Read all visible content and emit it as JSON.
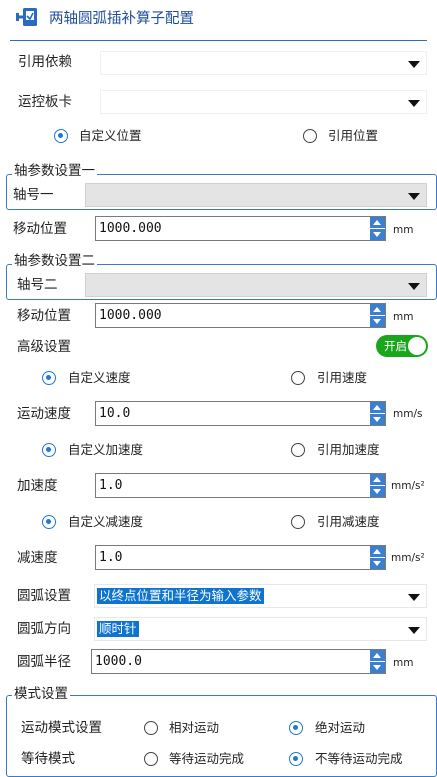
{
  "header": {
    "title": "两轴圆弧插补算子配置",
    "icon": "plugin-icon"
  },
  "colors": {
    "accent": "#1f78d1",
    "toggle_on": "#1aa61a",
    "selection": "#0f74d0",
    "group_border": "#3a78c8"
  },
  "ref_dependency": {
    "label": "引用依赖",
    "value": ""
  },
  "motion_card": {
    "label": "运控板卡",
    "value": ""
  },
  "position_mode": {
    "option_custom": "自定义位置",
    "option_ref": "引用位置",
    "selected": "custom"
  },
  "axis1": {
    "group_title": "轴参数设置一",
    "axis_label": "轴号一",
    "axis_value": "",
    "move_label": "移动位置",
    "move_value": "1000.000",
    "move_unit": "mm"
  },
  "axis2": {
    "group_title": "轴参数设置二",
    "axis_label": "轴号二",
    "axis_value": "",
    "move_label": "移动位置",
    "move_value": "1000.000",
    "move_unit": "mm"
  },
  "advanced": {
    "label": "高级设置",
    "toggle_text": "开启",
    "enabled": true
  },
  "speed_mode": {
    "option_custom": "自定义速度",
    "option_ref": "引用速度",
    "selected": "custom"
  },
  "speed": {
    "label": "运动速度",
    "value": "10.0",
    "unit": "mm/s"
  },
  "accel_mode": {
    "option_custom": "自定义加速度",
    "option_ref": "引用加速度",
    "selected": "custom"
  },
  "accel": {
    "label": "加速度",
    "value": "1.0",
    "unit": "mm/s²"
  },
  "decel_mode": {
    "option_custom": "自定义减速度",
    "option_ref": "引用减速度",
    "selected": "custom"
  },
  "decel": {
    "label": "减速度",
    "value": "1.0",
    "unit": "mm/s²"
  },
  "arc_setting": {
    "label": "圆弧设置",
    "value": "以终点位置和半径为输入参数"
  },
  "arc_direction": {
    "label": "圆弧方向",
    "value": "顺时针"
  },
  "arc_radius": {
    "label": "圆弧半径",
    "value": "1000.0",
    "unit": "mm"
  },
  "mode_settings": {
    "group_title": "模式设置",
    "motion_mode_label": "运动模式设置",
    "motion_relative": "相对运动",
    "motion_absolute": "绝对运动",
    "motion_selected": "absolute",
    "wait_label": "等待模式",
    "wait_done": "等待运动完成",
    "wait_not_done": "不等待运动完成",
    "wait_selected": "not_done"
  }
}
